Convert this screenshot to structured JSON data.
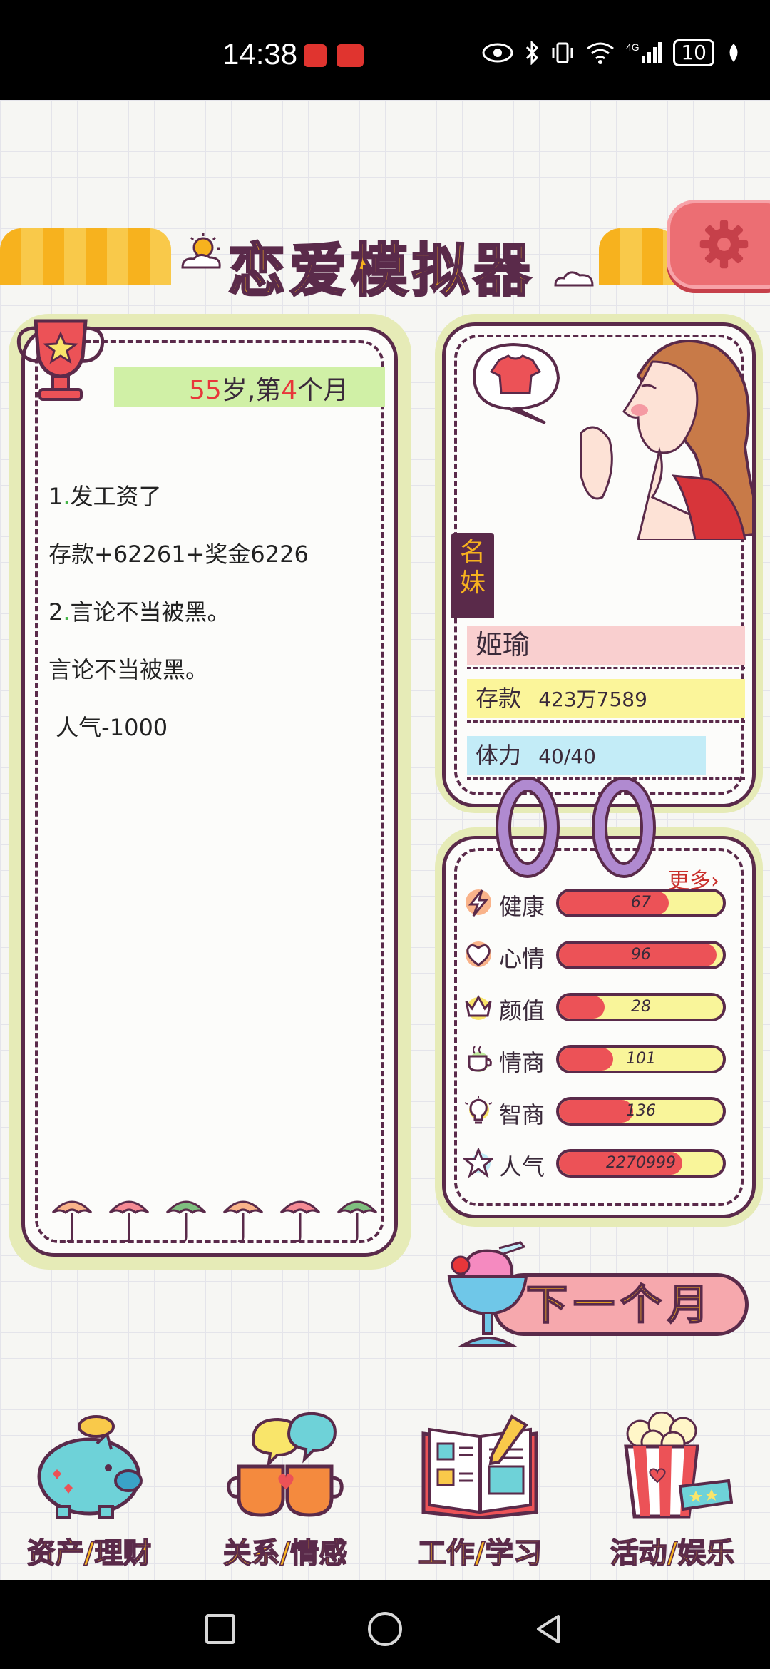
{
  "status_bar": {
    "time": "14:38",
    "battery": "10",
    "icons": [
      "eye-icon",
      "bluetooth-icon",
      "vibrate-icon",
      "wifi-icon",
      "4g-signal-icon",
      "battery-icon",
      "leaf-icon"
    ]
  },
  "header": {
    "title": "恋爱模拟器",
    "settings_icon": "gear-icon"
  },
  "log": {
    "age_number": "55",
    "age_suffix": "岁,第",
    "month_number": "4",
    "month_suffix": "个月",
    "events": [
      {
        "index": "1",
        "text": "发工资了"
      },
      {
        "index": "",
        "text": "存款+62261+奖金6226"
      },
      {
        "index": "2",
        "text": "言论不当被黑。"
      },
      {
        "index": "",
        "text": "言论不当被黑。"
      },
      {
        "index": "",
        "text": " 人气-1000"
      }
    ]
  },
  "profile": {
    "title_badge": "名妹",
    "name": "姬瑜",
    "savings_label": "存款",
    "savings_value": "423万7589",
    "stamina_label": "体力",
    "stamina_value": "40/40"
  },
  "stats": {
    "more_label": "更多›",
    "items": [
      {
        "label": "健康",
        "value": "67",
        "fill_pct": 67,
        "icon": "lightning-icon"
      },
      {
        "label": "心情",
        "value": "96",
        "fill_pct": 96,
        "icon": "heart-icon"
      },
      {
        "label": "颜值",
        "value": "28",
        "fill_pct": 28,
        "icon": "crown-icon"
      },
      {
        "label": "情商",
        "value": "101",
        "fill_pct": 33,
        "icon": "tea-cup-icon"
      },
      {
        "label": "智商",
        "value": "136",
        "fill_pct": 45,
        "icon": "lightbulb-icon"
      },
      {
        "label": "人气",
        "value": "2270999",
        "fill_pct": 75,
        "icon": "star-icon"
      }
    ]
  },
  "actions": {
    "next_month": "下一个月"
  },
  "menu": [
    {
      "label": "资产/理财",
      "icon": "piggy-bank-icon"
    },
    {
      "label": "关系/情感",
      "icon": "coffee-cups-icon"
    },
    {
      "label": "工作/学习",
      "icon": "open-book-icon"
    },
    {
      "label": "活动/娱乐",
      "icon": "popcorn-icon"
    }
  ],
  "colors": {
    "accent_yellow": "#f7b21e",
    "outline_purple": "#5a2a4a",
    "bar_red": "#ec5257",
    "bar_yellow": "#f9f59a",
    "panel_green": "#e6ebb7"
  }
}
